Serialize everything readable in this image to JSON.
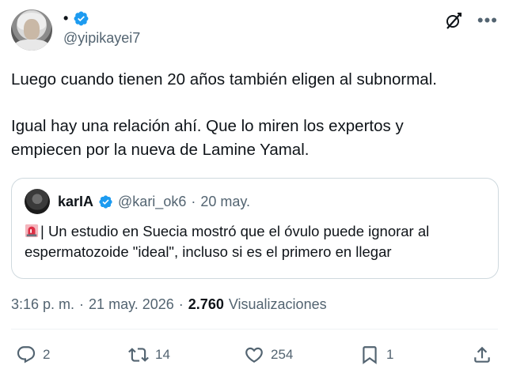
{
  "author": {
    "display_name": "•",
    "handle": "@yipikayei7"
  },
  "tweet": {
    "paragraph1": "Luego cuando tienen 20 años también eligen al subnormal.",
    "paragraph2_line1": "Igual hay una relación ahí. Que lo miren los expertos y",
    "paragraph2_line2": "empiecen por la nueva de Lamine Yamal."
  },
  "quote": {
    "display_name": "karIA",
    "handle": "@kari_ok6",
    "separator": "·",
    "date": "20 may.",
    "emoji": "rotating-light-emoji",
    "text_line1": "| Un estudio en Suecia mostró que el óvulo puede ignorar al",
    "text_line2": "espermatozoide \"ideal\",  incluso si es el primero en llegar"
  },
  "meta": {
    "time": "3:16 p. m.",
    "sep1": "·",
    "date": "21 may. 2026",
    "sep2": "·",
    "views_count": "2.760",
    "views_label": "Visualizaciones"
  },
  "actions": {
    "replies": "2",
    "reposts": "14",
    "likes": "254",
    "bookmarks": "1"
  },
  "colors": {
    "verified_blue": "#1d9bf0",
    "secondary_text": "#536471",
    "primary_text": "#0f1419",
    "border": "#cfd9de"
  },
  "icons": [
    "verified-badge-icon",
    "grok-icon",
    "more-icon",
    "reply-icon",
    "repost-icon",
    "like-icon",
    "bookmark-icon",
    "share-icon"
  ]
}
